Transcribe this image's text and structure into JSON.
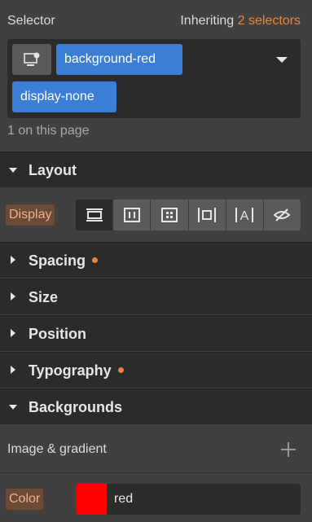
{
  "selector": {
    "title": "Selector",
    "inheriting_prefix": "Inheriting",
    "inheriting_count": "2 selectors",
    "chips": [
      "background-red",
      "display-none"
    ],
    "on_page": "1 on this page"
  },
  "sections": {
    "layout": "Layout",
    "spacing": "Spacing",
    "size": "Size",
    "position": "Position",
    "typography": "Typography",
    "backgrounds": "Backgrounds"
  },
  "layout": {
    "display_label": "Display",
    "display_options": [
      {
        "icon": "display-block-icon",
        "selected": true
      },
      {
        "icon": "display-flex-icon",
        "selected": false
      },
      {
        "icon": "display-grid-icon",
        "selected": false
      },
      {
        "icon": "display-inline-block-icon",
        "selected": false
      },
      {
        "icon": "display-inline-icon",
        "selected": false
      },
      {
        "icon": "display-none-icon",
        "selected": false
      }
    ]
  },
  "backgrounds": {
    "image_gradient_label": "Image & gradient",
    "color_label": "Color",
    "color_value": "red",
    "color_swatch": "#ff0000"
  },
  "colors": {
    "accent": "#e8843f",
    "chip": "#3c7dd6"
  }
}
